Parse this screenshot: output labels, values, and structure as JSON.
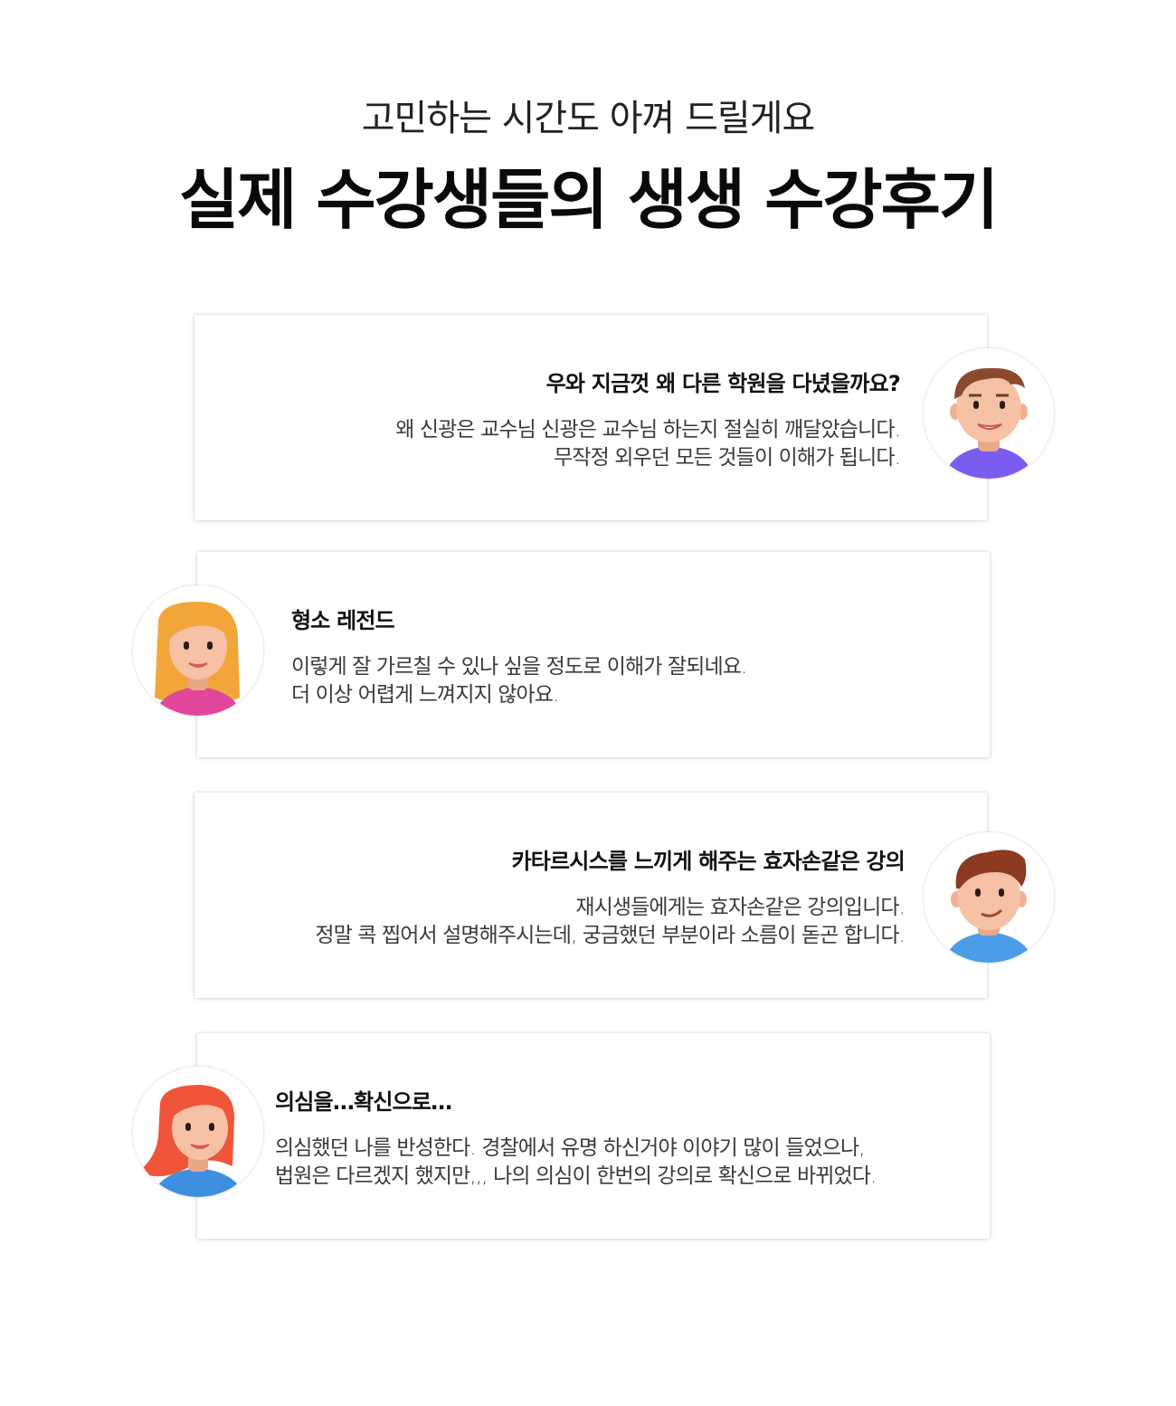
{
  "header": {
    "subtitle": "고민하는 시간도 아껴 드릴게요",
    "title": "실제 수강생들의 생생 수강후기"
  },
  "reviews": [
    {
      "heading": "우와 지금껏 왜 다른 학원을 다녔을까요?",
      "lines": [
        "왜 신광은 교수님 신광은 교수님 하는지 절실히 깨달았습니다.",
        "무작정 외우던 모든 것들이 이해가 됩니다."
      ],
      "avatar": "male-avatar-1",
      "shirt_color": "#7b5cf0"
    },
    {
      "heading": "형소 레전드",
      "lines": [
        "이렇게 잘 가르칠 수 있나 싶을 정도로 이해가 잘되네요.",
        "더 이상 어렵게 느껴지지 않아요."
      ],
      "avatar": "female-avatar-1",
      "shirt_color": "#e0479a"
    },
    {
      "heading": "카타르시스를 느끼게 해주는 효자손같은 강의",
      "lines": [
        "재시생들에게는 효자손같은 강의입니다.",
        "정말 콕 찝어서 설명해주시는데, 궁금했던 부분이라 소름이 돋곤 합니다."
      ],
      "avatar": "male-avatar-2",
      "shirt_color": "#4a9ee8"
    },
    {
      "heading": "의심을…확신으로…",
      "lines": [
        "의심했던 나를 반성한다. 경찰에서 유명 하신거야 이야기 많이 들었으나,",
        "법원은 다르겠지 했지만,,, 나의 의심이 한번의 강의로 확신으로 바뀌었다."
      ],
      "avatar": "female-avatar-2",
      "shirt_color": "#3f8fe0"
    }
  ]
}
